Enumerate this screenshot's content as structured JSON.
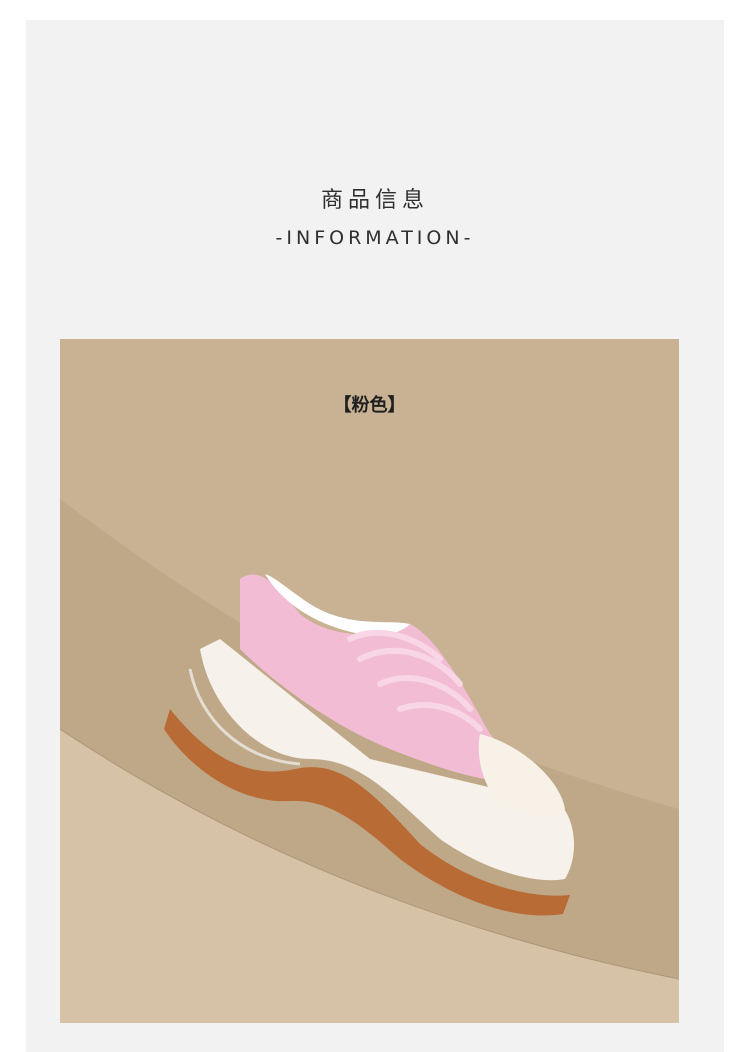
{
  "header": {
    "title_cn": "商品信息",
    "title_en": "-INFORMATION-"
  },
  "product": {
    "color_label": "【粉色】",
    "image_icon": "pink-platform-sneaker-illustration"
  },
  "colors": {
    "panel_bg": "#f2f2f2",
    "backdrop": "#c7b192",
    "shoe_upper": "#f3bfd6",
    "sole": "#f7f2ea",
    "outsole": "#b76a35"
  }
}
